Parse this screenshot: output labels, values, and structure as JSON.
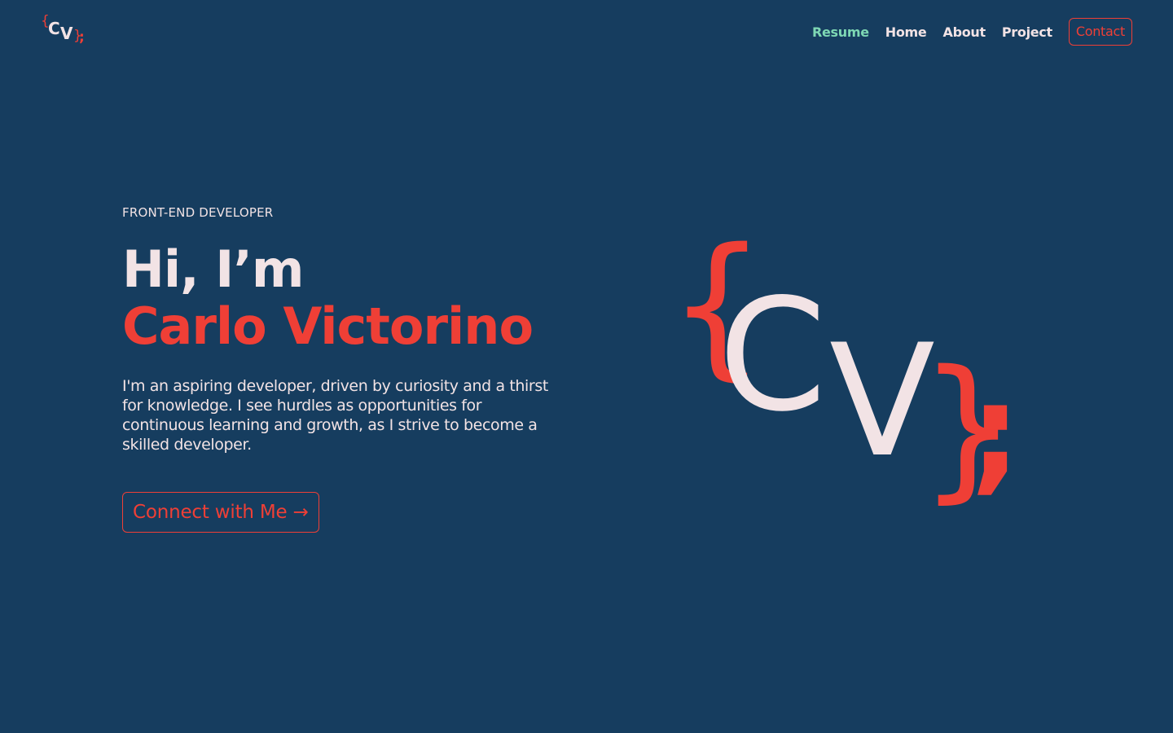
{
  "logo": {
    "open_brace": "{",
    "c": "C",
    "v": "V",
    "close_brace": "}",
    "semicolon": ";"
  },
  "nav": {
    "items": [
      {
        "label": "Resume",
        "active": true
      },
      {
        "label": "Home"
      },
      {
        "label": "About"
      },
      {
        "label": "Project"
      }
    ],
    "contact_label": "Contact"
  },
  "hero": {
    "eyebrow": "FRONT-END DEVELOPER",
    "greeting": "Hi, I’m",
    "name": "Carlo Victorino",
    "bio": "I'm an aspiring developer, driven by curiosity and a thirst for knowledge. I see hurdles as opportunities for continuous learning and growth, as I strive to become a skilled developer.",
    "cta_label": "Connect with Me →"
  },
  "colors": {
    "background": "#163d5f",
    "accent": "#ef3f36",
    "text": "#f2e3e5",
    "active_nav": "#7ed8b4"
  }
}
